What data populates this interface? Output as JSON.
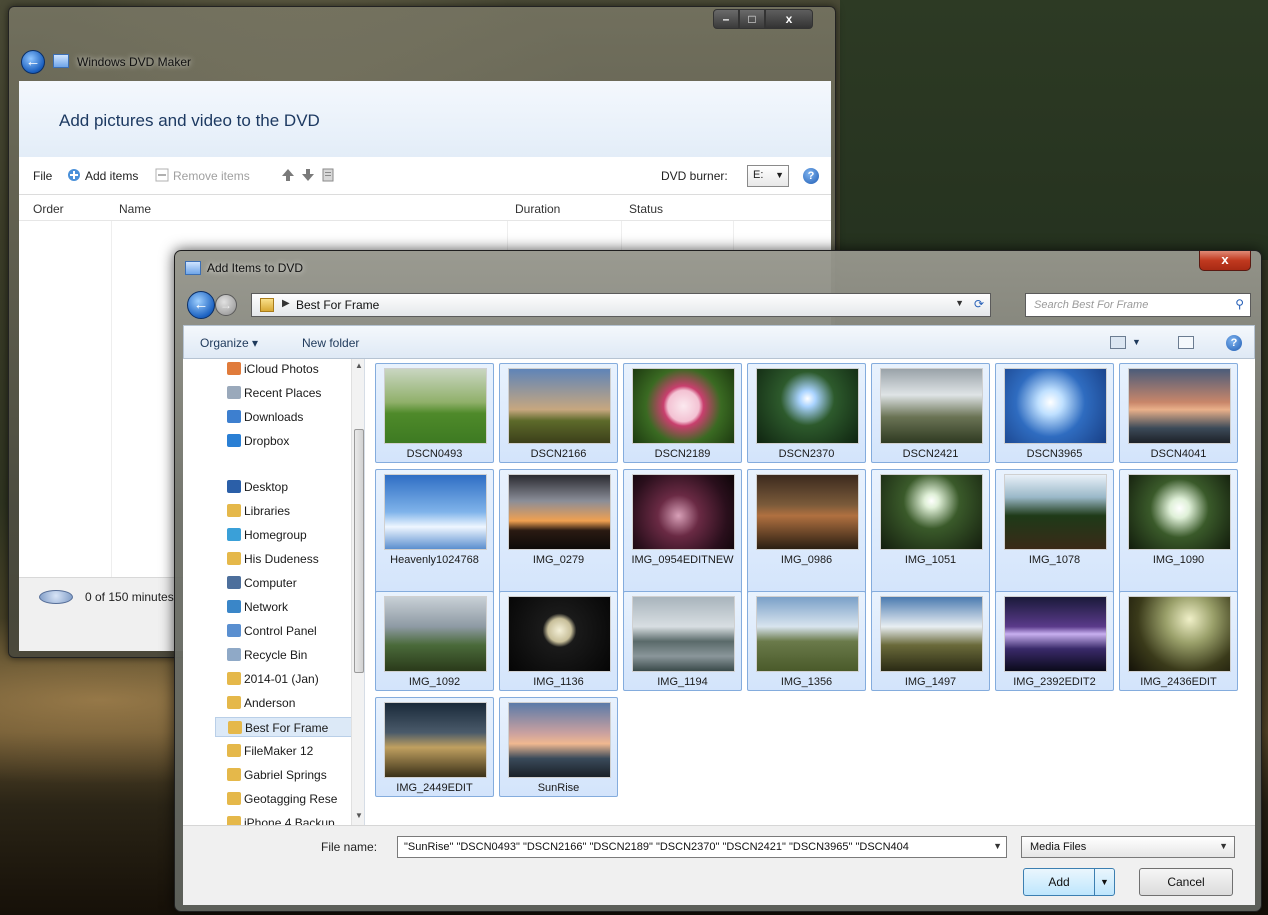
{
  "dvd_window": {
    "title": "Windows DVD Maker",
    "caption": {
      "minimize": "–",
      "maximize": "□",
      "close": "x"
    },
    "heading": "Add pictures and video to the DVD",
    "toolbar": {
      "file": "File",
      "add_items": "Add items",
      "remove_items": "Remove items",
      "dvd_burner_label": "DVD burner:",
      "dvd_burner_value": "E:"
    },
    "columns": [
      "Order",
      "Name",
      "Duration",
      "Status"
    ],
    "minutes": "0 of 150 minutes"
  },
  "dialog": {
    "title": "Add Items to DVD",
    "close": "x",
    "address": "Best For Frame",
    "search_placeholder": "Search Best For Frame",
    "organize": "Organize ▾",
    "new_folder": "New folder",
    "nav_items": [
      {
        "label": "iCloud Photos",
        "icon": "cloud-icon",
        "color": "#e07b3b"
      },
      {
        "label": "Recent Places",
        "icon": "recent-places-icon",
        "color": "#9aa9bb"
      },
      {
        "label": "Downloads",
        "icon": "downloads-icon",
        "color": "#3d7fcf"
      },
      {
        "label": "Dropbox",
        "icon": "dropbox-icon",
        "color": "#2a7fd4"
      },
      {
        "label": "Desktop",
        "icon": "desktop-icon",
        "color": "#2b5fa8"
      },
      {
        "label": "Libraries",
        "icon": "libraries-icon",
        "color": "#e5b84a"
      },
      {
        "label": "Homegroup",
        "icon": "homegroup-icon",
        "color": "#3aa0d8"
      },
      {
        "label": "His Dudeness",
        "icon": "user-folder-icon",
        "color": "#e5b84a"
      },
      {
        "label": "Computer",
        "icon": "computer-icon",
        "color": "#4d6f9c"
      },
      {
        "label": "Network",
        "icon": "network-icon",
        "color": "#3a86c8"
      },
      {
        "label": "Control Panel",
        "icon": "control-panel-icon",
        "color": "#5a8fd0"
      },
      {
        "label": "Recycle Bin",
        "icon": "recycle-bin-icon",
        "color": "#8fa9c7"
      },
      {
        "label": "2014-01 (Jan)",
        "icon": "folder-icon",
        "color": "#e5b84a"
      },
      {
        "label": "Anderson",
        "icon": "folder-icon",
        "color": "#e5b84a"
      },
      {
        "label": "Best For Frame",
        "icon": "folder-icon",
        "color": "#e5b84a",
        "selected": true
      },
      {
        "label": "FileMaker 12",
        "icon": "folder-icon",
        "color": "#e5b84a"
      },
      {
        "label": "Gabriel Springs",
        "icon": "folder-icon",
        "color": "#e5b84a"
      },
      {
        "label": "Geotagging Rese",
        "icon": "folder-icon",
        "color": "#e5b84a"
      },
      {
        "label": "iPhone 4 Backup",
        "icon": "folder-icon",
        "color": "#e5b84a"
      }
    ],
    "files": [
      {
        "name": "DSCN0493",
        "thumb": "linear-gradient(180deg,#c9d6c1 0%,#90b06a 45%,#4f8a2a 60%,#3d7a22 100%)"
      },
      {
        "name": "DSCN2166",
        "thumb": "linear-gradient(180deg,#5f84b8 0%,#c7a77f 55%,#5d6a2a 70%,#3c3f1a 100%)"
      },
      {
        "name": "DSCN2189",
        "thumb": "radial-gradient(circle at 50% 50%,#fbe9ef 0%,#f3c2d3 25%,#c93f6e 32%,#3a6a22 60%,#1d3a10 100%)"
      },
      {
        "name": "DSCN2370",
        "thumb": "radial-gradient(circle at 50% 40%,#ffffff 0%,#a9d3ff 12%,#2d5a2c 40%,#0f2410 100%)"
      },
      {
        "name": "DSCN2421",
        "thumb": "linear-gradient(180deg,#9aa3a9 0%,#dfe4e6 35%,#6a7354 65%,#2f3a22 100%)"
      },
      {
        "name": "DSCN3965",
        "thumb": "radial-gradient(circle at 45% 45%,#ffffff 0%,#bfe0ff 18%,#2f6cc0 50%,#183f86 100%)"
      },
      {
        "name": "DSCN4041",
        "thumb": "linear-gradient(180deg,#4b5c7a 0%,#c8866a 45%,#e9b08a 55%,#3c4a58 80%,#1d2128 100%)"
      },
      {
        "name": "Heavenly1024768",
        "thumb": "linear-gradient(180deg,#2f6ec4 0%,#7fb3ea 50%,#eef6ff 70%,#5b8fcf 100%)"
      },
      {
        "name": "IMG_0279",
        "thumb": "linear-gradient(180deg,#2a2a30 0%,#8a8d98 35%,#f0a050 62%,#2a1a12 75%,#0d0a08 100%)"
      },
      {
        "name": "IMG_0954EDITNEW",
        "thumb": "radial-gradient(circle at 45% 55%,#d8a0b8 0%,#6a2a44 30%,#2a0f1c 70%,#0d0508 100%)"
      },
      {
        "name": "IMG_0986",
        "thumb": "linear-gradient(180deg,#3c2a1e 0%,#7a5a3a 40%,#b07040 55%,#2a1e12 100%)"
      },
      {
        "name": "IMG_1051",
        "thumb": "radial-gradient(circle at 50% 35%,#ffffff 0%,#e0f0d8 10%,#3a5a2a 40%,#141e0e 100%)"
      },
      {
        "name": "IMG_1078",
        "thumb": "linear-gradient(180deg,#e8f0f8 0%,#9ab8c8 30%,#1e3a18 55%,#3a2a18 100%)"
      },
      {
        "name": "IMG_1090",
        "thumb": "radial-gradient(circle at 50% 45%,#ffffff 0%,#dff0d8 15%,#3a5a2a 45%,#121c0c 100%)"
      },
      {
        "name": "IMG_1092",
        "thumb": "linear-gradient(180deg,#c8d0d6 0%,#8e9aa4 40%,#4a6a3a 65%,#2a3a1a 100%)"
      },
      {
        "name": "IMG_1136",
        "thumb": "radial-gradient(circle at 50% 45%,#f4f0d8 0%,#c8bf9a 18%,#1a1a1a 26%,#050505 100%)"
      },
      {
        "name": "IMG_1194",
        "thumb": "linear-gradient(180deg,#a8b4bc 0%,#d8dee2 40%,#5a6a6a 60%,#8a969a 80%,#3a4a4a 100%)"
      },
      {
        "name": "IMG_1356",
        "thumb": "linear-gradient(180deg,#7aa0c8 0%,#d8e4ee 40%,#6a7a4a 60%,#4a5a2a 100%)"
      },
      {
        "name": "IMG_1497",
        "thumb": "linear-gradient(180deg,#4a7ab0 0%,#e8eef2 40%,#6a6a3a 65%,#2a2a14 100%)"
      },
      {
        "name": "IMG_2392EDIT2",
        "thumb": "linear-gradient(180deg,#1a1a3a 0%,#5a3a8a 40%,#c8b0f0 50%,#3a2a6a 70%,#0a0a1a 100%)"
      },
      {
        "name": "IMG_2436EDIT",
        "thumb": "radial-gradient(circle at 60% 30%,#f0f0c8 0%,#9aa06a 30%,#3a3a1a 65%,#141208 100%)"
      },
      {
        "name": "IMG_2449EDIT",
        "thumb": "linear-gradient(180deg,#1a2a3a 0%,#4a5a6a 40%,#c0a060 60%,#3a3018 100%)"
      },
      {
        "name": "SunRise",
        "thumb": "linear-gradient(180deg,#5a7aa8 0%,#c8a0a0 40%,#f0b890 55%,#3a4a5a 75%,#1a2028 100%)"
      }
    ],
    "file_name_label": "File name:",
    "file_name_value": "\"SunRise\" \"DSCN0493\" \"DSCN2166\" \"DSCN2189\" \"DSCN2370\" \"DSCN2421\" \"DSCN3965\" \"DSCN404",
    "file_type": "Media Files",
    "add_button": "Add",
    "cancel_button": "Cancel"
  }
}
